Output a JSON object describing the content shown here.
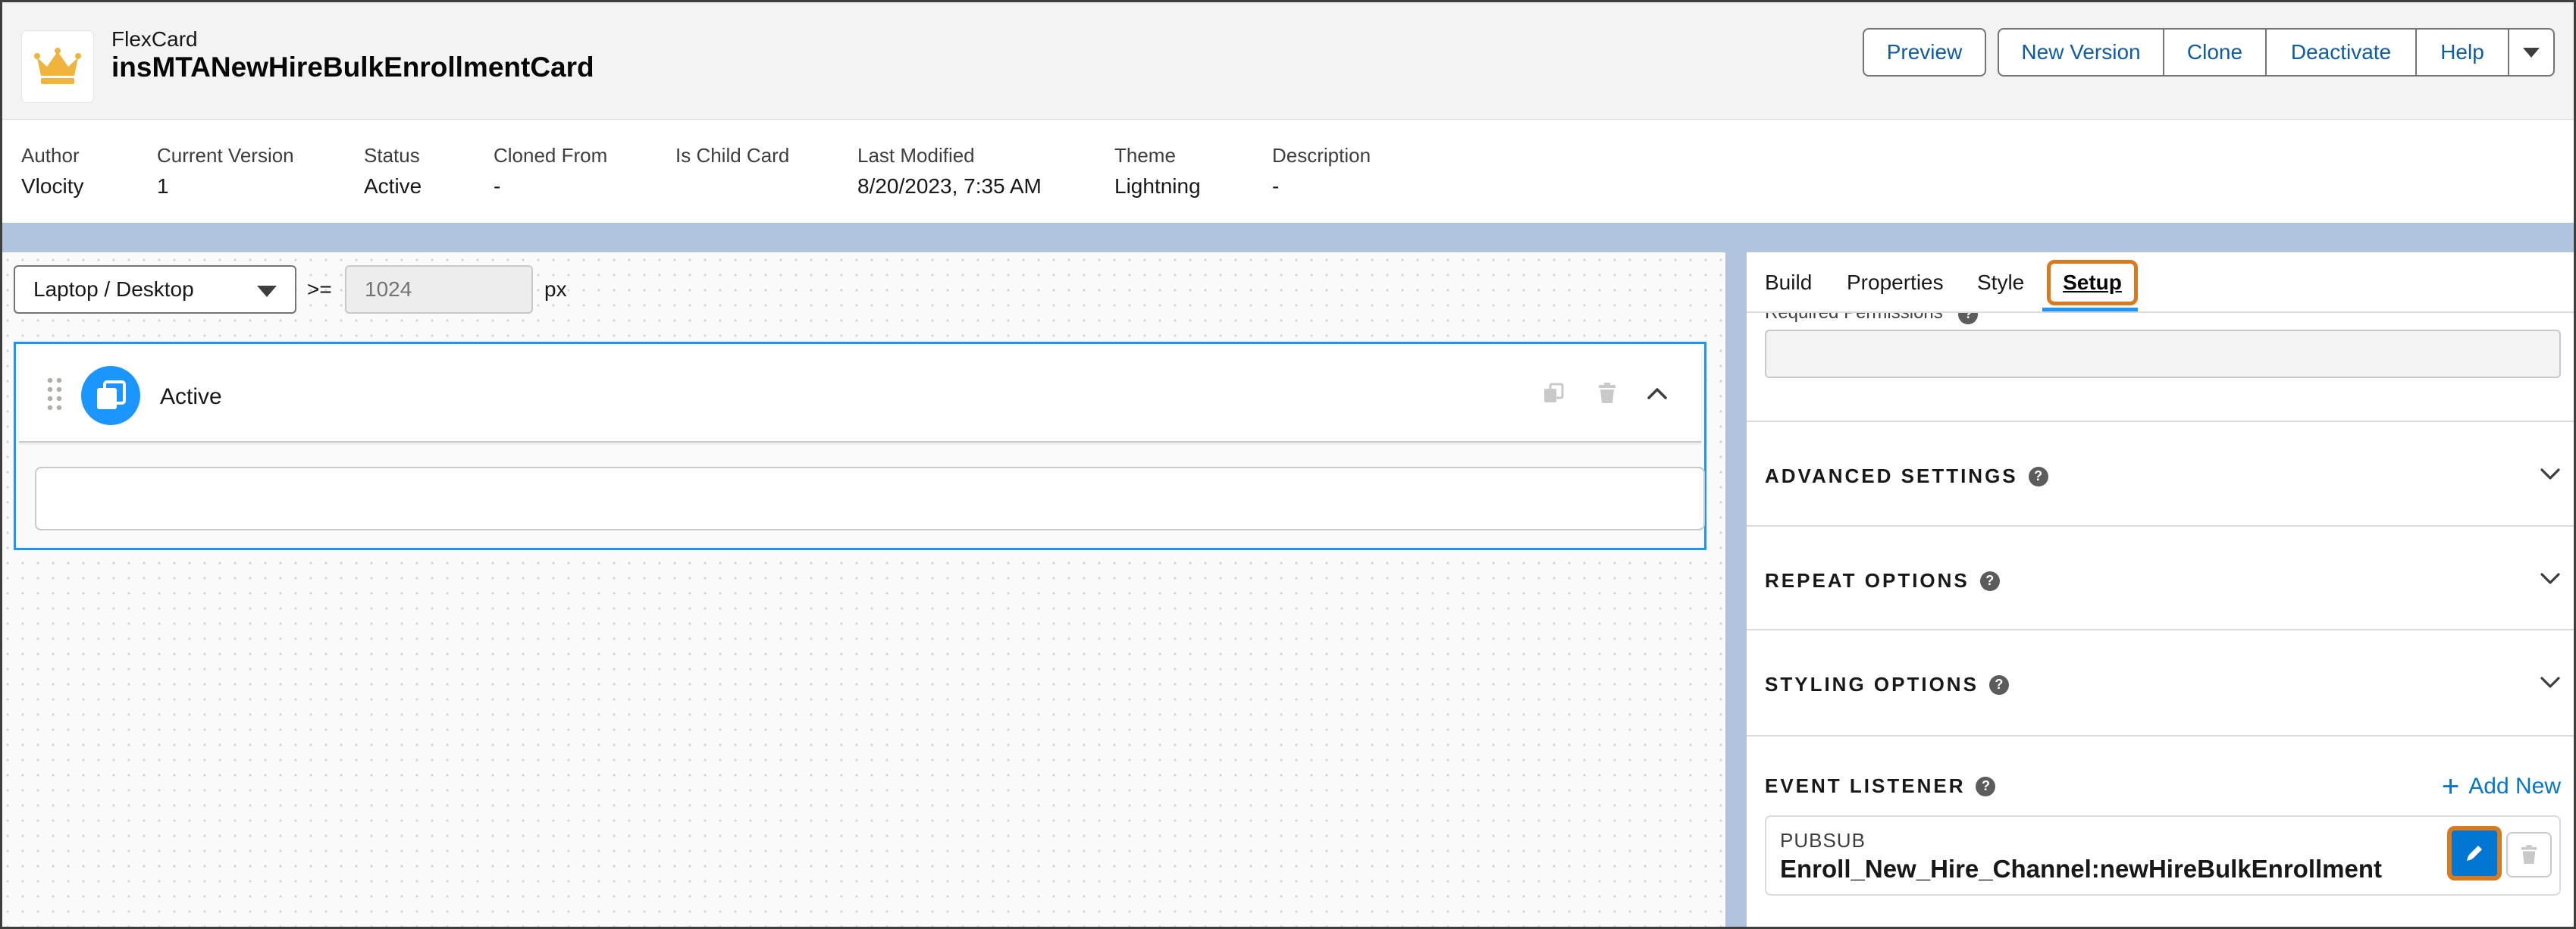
{
  "header": {
    "type_label": "FlexCard",
    "card_name": "insMTANewHireBulkEnrollmentCard",
    "buttons": {
      "preview": "Preview",
      "new_version": "New Version",
      "clone": "Clone",
      "deactivate": "Deactivate",
      "help": "Help"
    }
  },
  "meta": [
    {
      "label": "Author",
      "value": "Vlocity"
    },
    {
      "label": "Current Version",
      "value": "1"
    },
    {
      "label": "Status",
      "value": "Active"
    },
    {
      "label": "Cloned From",
      "value": "-"
    },
    {
      "label": "Is Child Card",
      "value": ""
    },
    {
      "label": "Last Modified",
      "value": "8/20/2023, 7:35 AM"
    },
    {
      "label": "Theme",
      "value": "Lightning"
    },
    {
      "label": "Description",
      "value": "-"
    }
  ],
  "canvas": {
    "device": "Laptop / Desktop",
    "operator": ">=",
    "min_width": "1024",
    "unit": "px",
    "state_name": "Active"
  },
  "panel": {
    "tabs": [
      "Build",
      "Properties",
      "Style",
      "Setup"
    ],
    "active_tab": "Setup",
    "required_permissions_label": "Required Permissions",
    "sections": [
      "ADVANCED SETTINGS",
      "REPEAT OPTIONS",
      "STYLING OPTIONS"
    ],
    "event_listener": {
      "title": "EVENT LISTENER",
      "add_new": "Add New",
      "type": "PUBSUB",
      "name": "Enroll_New_Hire_Channel:newHireBulkEnrollment"
    }
  },
  "colors": {
    "brand_blue": "#0176d3",
    "active_outline": "#1b96ff",
    "highlight_orange": "#d97a1f",
    "crown_gold": "#f0b43c"
  }
}
